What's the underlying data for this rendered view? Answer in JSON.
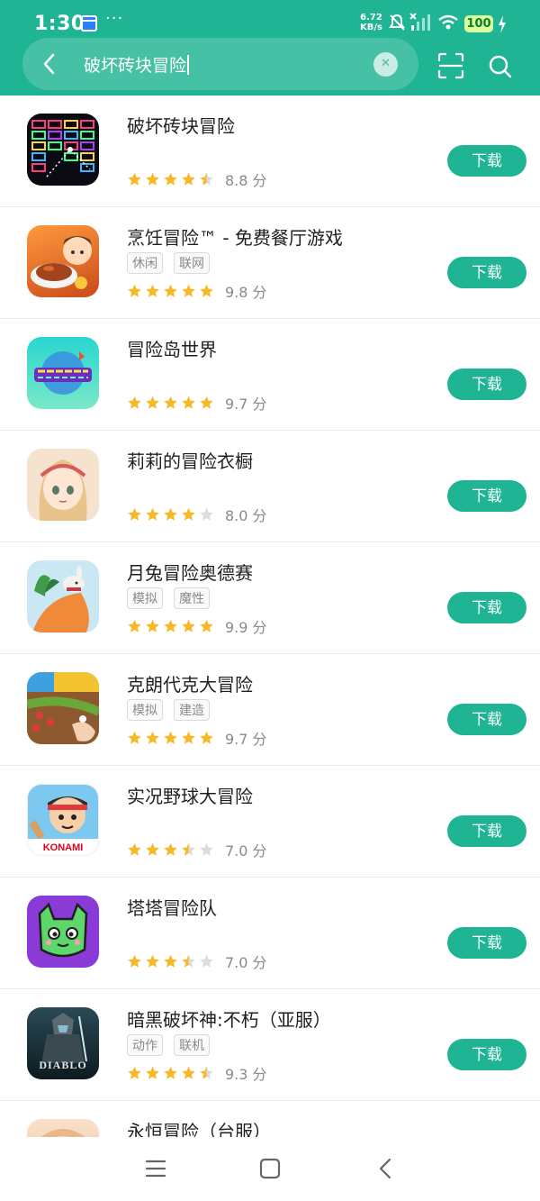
{
  "status_bar": {
    "time": "1:30",
    "more": "···",
    "net_speed_value": "6.72",
    "net_speed_unit": "KB/s",
    "battery": "100"
  },
  "search": {
    "query": "破坏砖块冒险"
  },
  "apps": [
    {
      "name": "破坏砖块冒险",
      "tags": [],
      "stars": 4.5,
      "score": "8.8 分",
      "button": "下载",
      "icon": "brick-breaker-icon"
    },
    {
      "name": "烹饪冒险™ - 免费餐厅游戏",
      "tags": [
        "休闲",
        "联网"
      ],
      "stars": 5,
      "score": "9.8 分",
      "button": "下载",
      "icon": "cooking-adventure-icon"
    },
    {
      "name": "冒险岛世界",
      "tags": [],
      "stars": 5,
      "score": "9.7 分",
      "button": "下载",
      "icon": "maplestory-worlds-icon"
    },
    {
      "name": "莉莉的冒险衣橱",
      "tags": [],
      "stars": 4,
      "score": "8.0 分",
      "button": "下载",
      "icon": "lily-wardrobe-icon"
    },
    {
      "name": "月兔冒险奥德赛",
      "tags": [
        "模拟",
        "魔性"
      ],
      "stars": 5,
      "score": "9.9 分",
      "button": "下载",
      "icon": "moon-rabbit-icon"
    },
    {
      "name": "克朗代克大冒险",
      "tags": [
        "模拟",
        "建造"
      ],
      "stars": 5,
      "score": "9.7 分",
      "button": "下载",
      "icon": "klondike-icon"
    },
    {
      "name": "实况野球大冒险",
      "tags": [],
      "stars": 3.5,
      "score": "7.0 分",
      "button": "下载",
      "icon": "power-pro-baseball-icon",
      "badge": "KONAMI"
    },
    {
      "name": "塔塔冒险队",
      "tags": [],
      "stars": 3.5,
      "score": "7.0 分",
      "button": "下载",
      "icon": "tata-team-icon"
    },
    {
      "name": "暗黑破坏神:不朽（亚服）",
      "tags": [
        "动作",
        "联机"
      ],
      "stars": 4.5,
      "score": "9.3 分",
      "button": "下载",
      "icon": "diablo-icon",
      "badge": "DIABLO"
    },
    {
      "name": "永恒冒险（台服）",
      "tags": [],
      "stars": 0,
      "score": "",
      "button": "",
      "icon": "eternal-adventure-icon"
    }
  ],
  "colors": {
    "brand": "#1fb493",
    "star": "#f7b928",
    "star_empty": "#dcdcdc"
  }
}
